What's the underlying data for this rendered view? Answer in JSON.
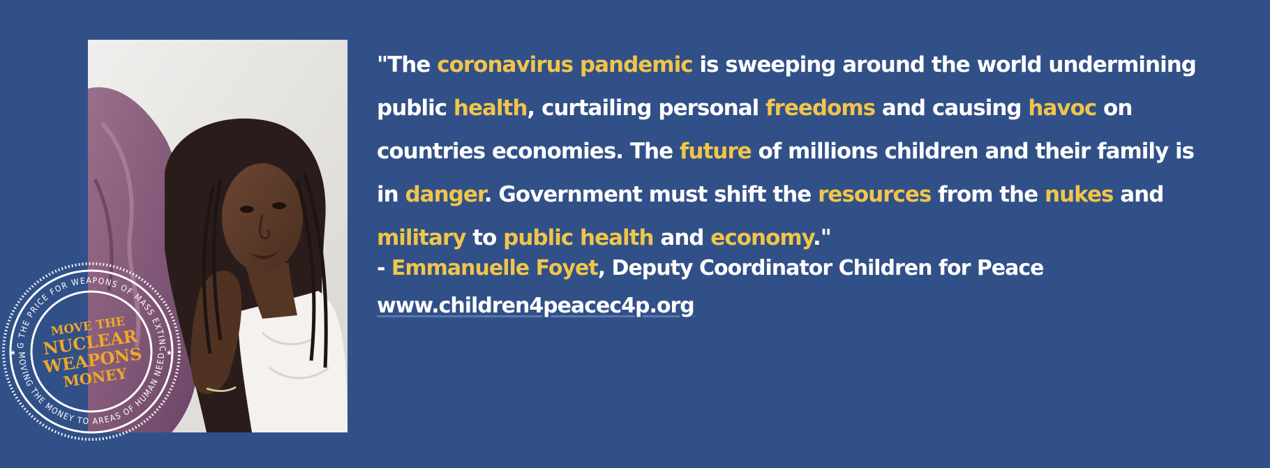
{
  "quote": {
    "open_mark": "\"",
    "segments": [
      {
        "text": "The ",
        "highlight": false
      },
      {
        "text": "coronavirus pandemic",
        "highlight": true
      },
      {
        "text": " is sweeping around the world undermining public ",
        "highlight": false
      },
      {
        "text": "health",
        "highlight": true
      },
      {
        "text": ", curtailing personal ",
        "highlight": false
      },
      {
        "text": "freedoms",
        "highlight": true
      },
      {
        "text": " and causing ",
        "highlight": false
      },
      {
        "text": "havoc",
        "highlight": true
      },
      {
        "text": " on countries economies. The ",
        "highlight": false
      },
      {
        "text": "future",
        "highlight": true
      },
      {
        "text": " of millions children and their family is in ",
        "highlight": false
      },
      {
        "text": "danger",
        "highlight": true
      },
      {
        "text": ". Government must shift the ",
        "highlight": false
      },
      {
        "text": "resources",
        "highlight": true
      },
      {
        "text": " from the ",
        "highlight": false
      },
      {
        "text": "nukes",
        "highlight": true
      },
      {
        "text": " and ",
        "highlight": false
      },
      {
        "text": "military",
        "highlight": true
      },
      {
        "text": " to ",
        "highlight": false
      },
      {
        "text": "public health",
        "highlight": true
      },
      {
        "text": " and ",
        "highlight": false
      },
      {
        "text": "economy",
        "highlight": true
      },
      {
        "text": ".\"",
        "highlight": false
      }
    ]
  },
  "credit": {
    "dash": "- ",
    "name": "Emmanuelle Foyet",
    "role": ", Deputy Coordinator Children for Peace",
    "url": "www.children4peacec4p.org"
  },
  "stamp": {
    "line1": "MOVE THE",
    "line2": "NUCLEAR",
    "line3": "WEAPONS",
    "line4": "MONEY",
    "ring_top": "PAYING THE PRICE FOR WEAPONS OF MASS EXTINCTION",
    "ring_bottom": "MOVING THE MONEY TO AREAS OF HUMAN NEED"
  },
  "colors": {
    "background": "#315088",
    "highlight": "#f0c54a",
    "text": "#ffffff"
  }
}
